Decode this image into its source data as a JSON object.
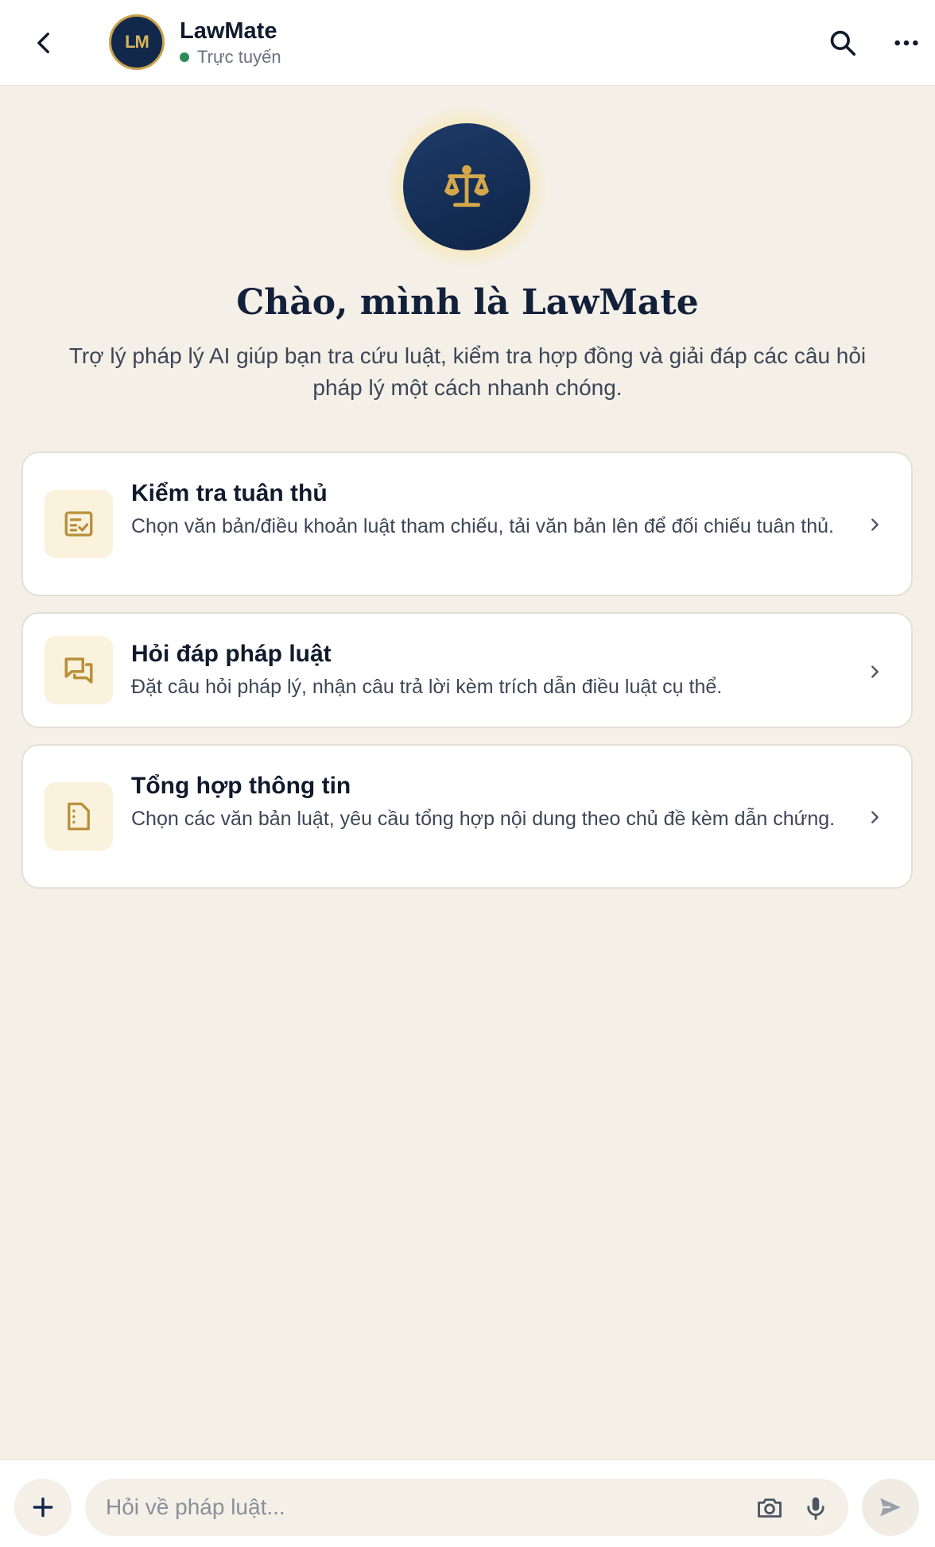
{
  "header": {
    "avatar_initials": "LM",
    "title": "LawMate",
    "status": "Trực tuyến",
    "status_color": "#2e8b57"
  },
  "hero": {
    "icon": "scale-icon",
    "title": "Chào, mình là LawMate",
    "subtitle": "Trợ lý pháp lý AI giúp bạn tra cứu luật, kiểm tra hợp đồng và giải đáp các câu hỏi pháp lý một cách nhanh chóng."
  },
  "cards": [
    {
      "icon": "checklist-icon",
      "title": "Kiểm tra tuân thủ",
      "description": "Chọn văn bản/điều khoản luật tham chiếu, tải văn bản lên để đối chiếu tuân thủ."
    },
    {
      "icon": "chat-bubbles-icon",
      "title": "Hỏi đáp pháp luật",
      "description": "Đặt câu hỏi pháp lý, nhận câu trả lời kèm trích dẫn điều luật cụ thể."
    },
    {
      "icon": "document-icon",
      "title": "Tổng hợp thông tin",
      "description": "Chọn các văn bản luật, yêu cầu tổng hợp nội dung theo chủ đề kèm dẫn chứng."
    }
  ],
  "composer": {
    "placeholder": "Hỏi về pháp luật...",
    "value": ""
  },
  "colors": {
    "navy": "#12284a",
    "gold": "#c9a24a",
    "background": "#f4f0e8"
  }
}
